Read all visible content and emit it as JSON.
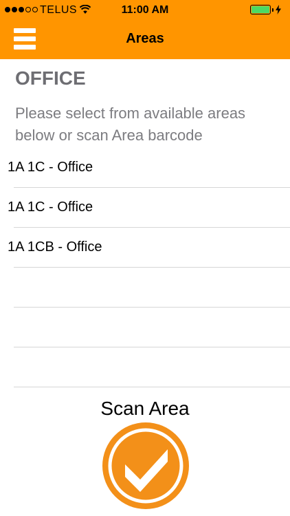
{
  "status_bar": {
    "carrier": "TELUS",
    "time": "11:00 AM",
    "signal_filled": 3,
    "signal_total": 5,
    "battery_color": "#4cd964"
  },
  "nav": {
    "title": "Areas",
    "menu_icon": "hamburger-menu-icon",
    "background_color": "#ff9500"
  },
  "content": {
    "heading": "OFFICE",
    "instructions": "Please select from available areas below or scan Area barcode"
  },
  "areas": [
    {
      "label": "1A 1C - Office"
    },
    {
      "label": "1A 1C - Office"
    },
    {
      "label": "1A 1CB - Office"
    },
    {
      "label": ""
    },
    {
      "label": ""
    },
    {
      "label": ""
    }
  ],
  "scan": {
    "label": "Scan Area",
    "icon": "checkmark-circle-icon",
    "accent_color": "#f39019"
  }
}
